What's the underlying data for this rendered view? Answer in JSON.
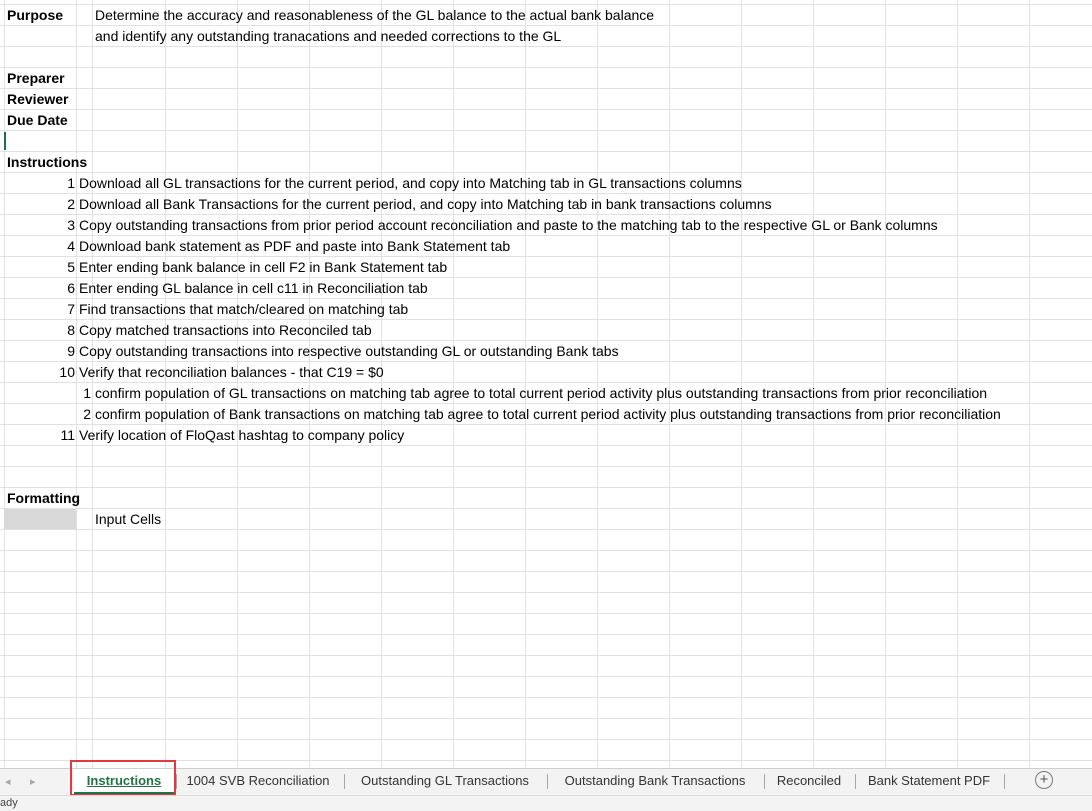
{
  "sheet": {
    "purpose_label": "Purpose",
    "purpose_line1": "Determine the accuracy and reasonableness of the GL balance to the actual bank balance",
    "purpose_line2": "and identify any outstanding tranacations and needed corrections to the GL",
    "preparer_label": "Preparer",
    "reviewer_label": "Reviewer",
    "due_date_label": "Due Date",
    "instructions_label": "Instructions",
    "instructions": [
      {
        "num": "1",
        "text": "Download all GL transactions for the current period, and copy into Matching tab in GL transactions columns"
      },
      {
        "num": "2",
        "text": "Download all Bank Transactions for the current period, and copy into Matching tab in bank transactions columns"
      },
      {
        "num": "3",
        "text": "Copy outstanding transactions from prior period account reconciliation and paste to the matching tab to the respective GL or Bank columns"
      },
      {
        "num": "4",
        "text": "Download bank statement as PDF and paste into Bank Statement tab"
      },
      {
        "num": "5",
        "text": "Enter ending bank balance in cell F2 in Bank Statement tab"
      },
      {
        "num": "6",
        "text": "Enter ending GL balance in cell c11 in Reconciliation tab"
      },
      {
        "num": "7",
        "text": "Find transactions that match/cleared on matching tab"
      },
      {
        "num": "8",
        "text": "Copy matched transactions into Reconciled tab"
      },
      {
        "num": "9",
        "text": "Copy outstanding transactions into respective outstanding GL or outstanding Bank tabs"
      },
      {
        "num": "10",
        "text": "Verify that reconciliation balances - that C19 = $0"
      }
    ],
    "sub_instructions": [
      {
        "num": "1",
        "text": "confirm population of GL transactions on matching tab agree to total current period activity plus outstanding transactions from prior reconciliation"
      },
      {
        "num": "2",
        "text": "confirm population of Bank transactions on matching tab agree to total current period activity plus outstanding transactions from prior reconciliation"
      }
    ],
    "final_instruction": {
      "num": "11",
      "text": "Verify location of FloQast hashtag to company policy"
    },
    "formatting_label": "Formatting",
    "input_cells_label": "Input Cells",
    "input_fill_color": "#d9d9d9"
  },
  "tabs": [
    {
      "label": "Instructions",
      "active": true
    },
    {
      "label": "1004 SVB Reconciliation",
      "active": false
    },
    {
      "label": "Outstanding GL Transactions",
      "active": false
    },
    {
      "label": "Outstanding Bank Transactions",
      "active": false
    },
    {
      "label": "Reconciled",
      "active": false
    },
    {
      "label": "Bank Statement PDF",
      "active": false
    }
  ],
  "nav": {
    "prev_icon": "◂",
    "next_icon": "▸",
    "add_icon": "+"
  },
  "status": {
    "text": "ady"
  },
  "colors": {
    "accent": "#217346",
    "highlight": "#e0393e"
  }
}
